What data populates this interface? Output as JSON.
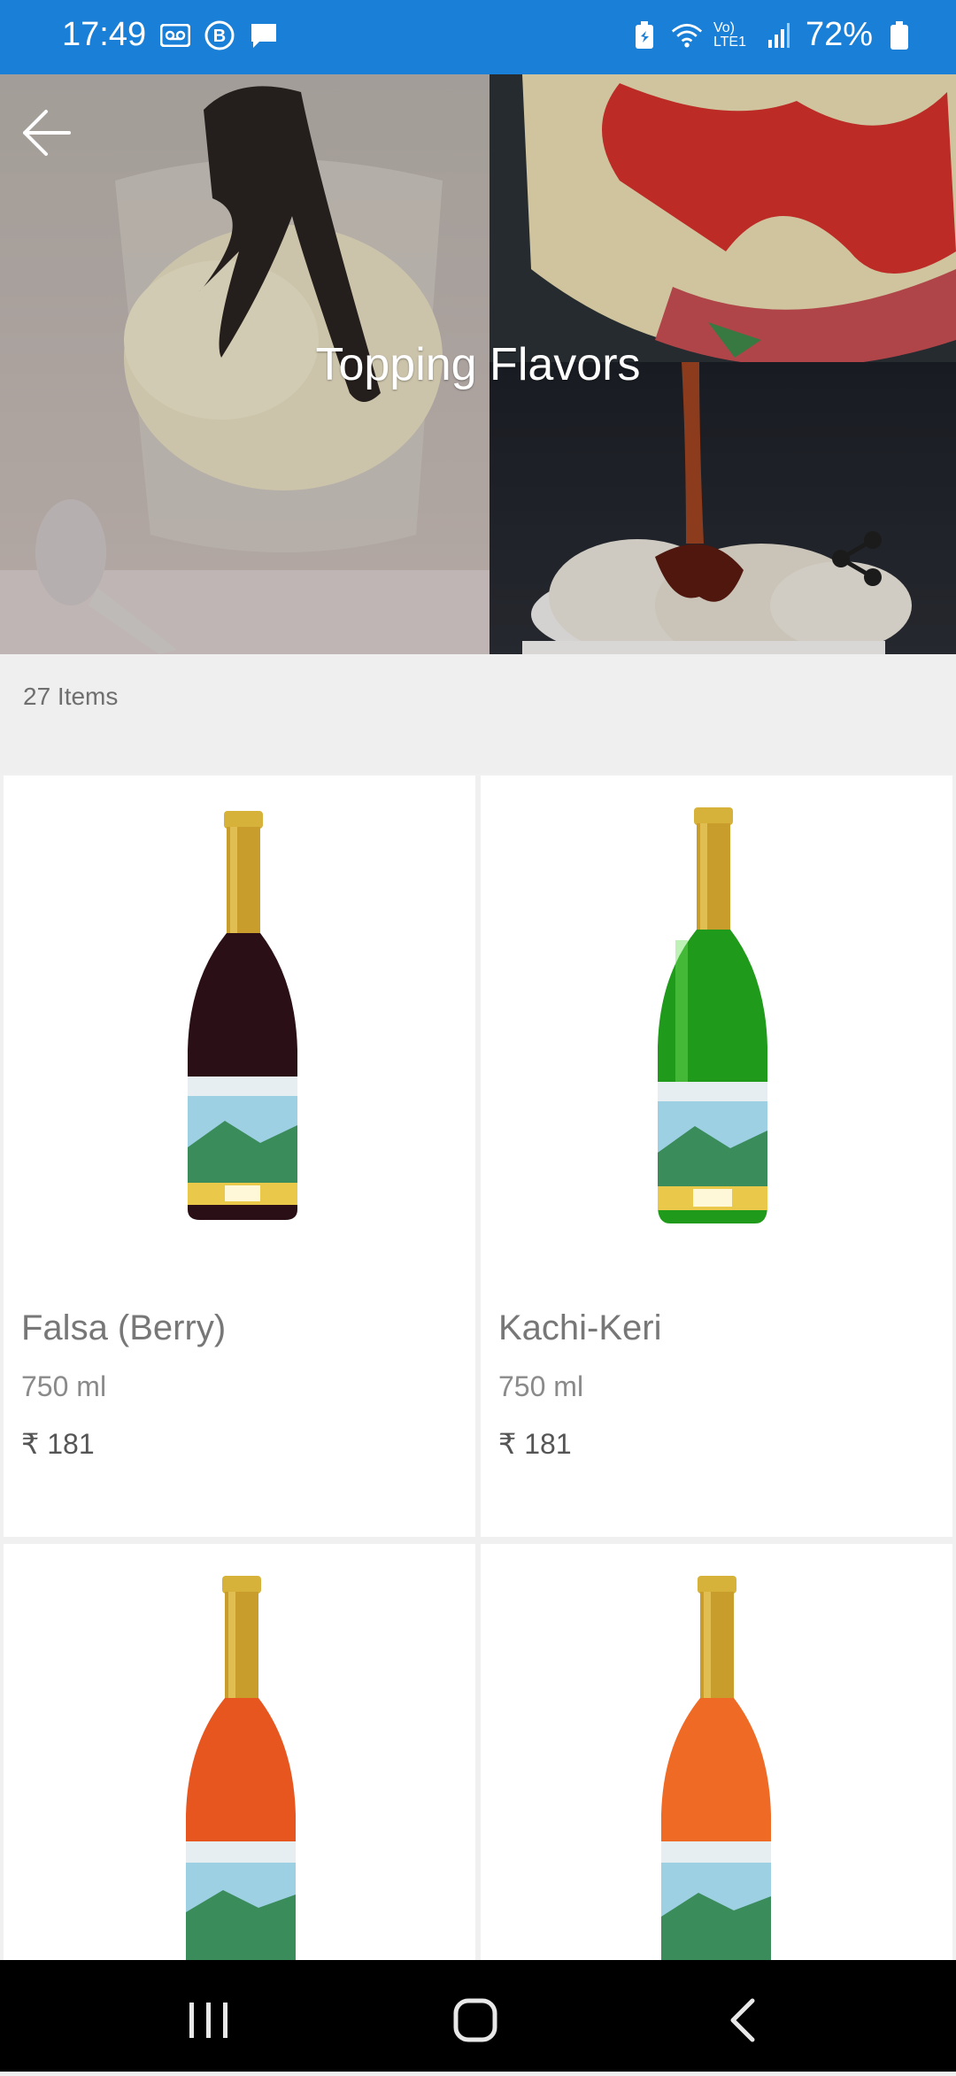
{
  "status_bar": {
    "time": "17:49",
    "battery": "72%",
    "network": "Vo) LTE1"
  },
  "header": {
    "title": "Topping Flavors",
    "back_icon": "arrow-left-icon",
    "share_icon": "share-icon"
  },
  "items_count": "27 Items",
  "products": [
    {
      "name": "Falsa (Berry)",
      "size": "750 ml",
      "price": "₹ 181",
      "color": "#2a1016"
    },
    {
      "name": "Kachi-Keri",
      "size": "750 ml",
      "price": "₹ 181",
      "color": "#1f9a1a"
    },
    {
      "name": "",
      "size": "",
      "price": "",
      "color": "#e8561f"
    },
    {
      "name": "",
      "size": "",
      "price": "",
      "color": "#ee6a25"
    }
  ],
  "colors": {
    "status_bar": "#1a7fd6",
    "nav_bar": "#000000"
  }
}
